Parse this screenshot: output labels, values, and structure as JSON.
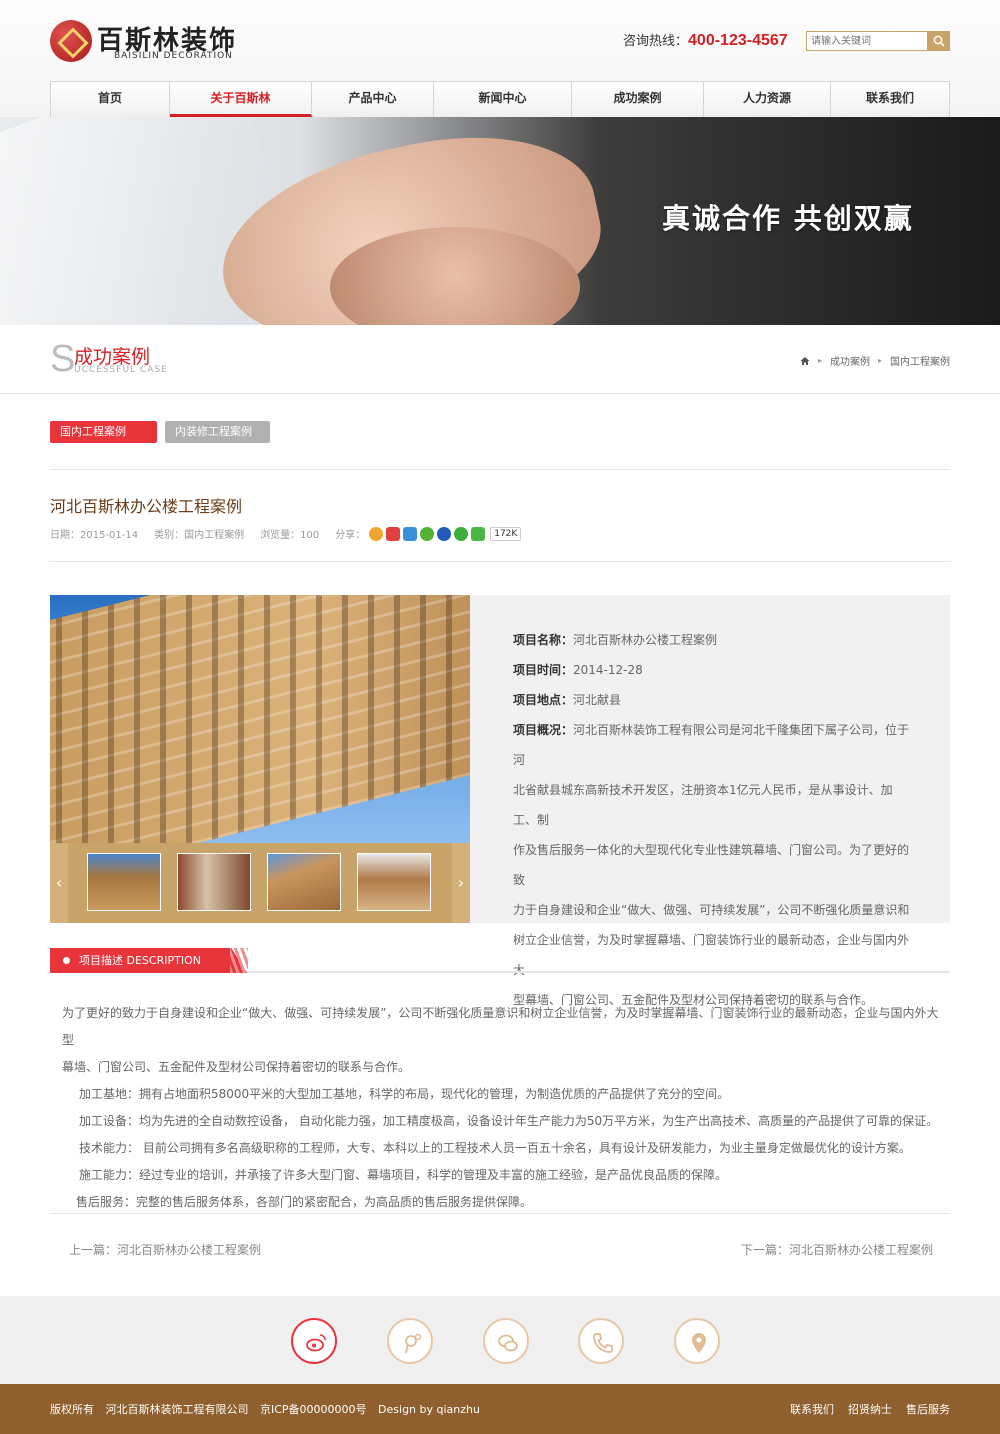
{
  "header": {
    "logo_cn": "百斯林装饰",
    "logo_en": "BAISILIN DECORATION",
    "hotline_label": "咨询热线：",
    "hotline_number": "400-123-4567",
    "search_placeholder": "请输入关键词"
  },
  "nav": [
    "首页",
    "关于百斯林",
    "产品中心",
    "新闻中心",
    "成功案例",
    "人力资源",
    "联系我们"
  ],
  "banner": {
    "slogan": "真诚合作  共创双赢"
  },
  "section": {
    "letter": "S",
    "title": "成功案例",
    "subtitle": "UCCESSFUL CASE",
    "breadcrumb": [
      "成功案例",
      "国内工程案例"
    ]
  },
  "tabs": {
    "domestic": "国内工程案例",
    "interior": "内装修工程案例"
  },
  "article": {
    "title": "河北百斯林办公楼工程案例",
    "date": "日期：2015-01-14",
    "category": "类别：国内工程案例",
    "views": "浏览量：100",
    "share_label": "分享：",
    "share_count": "172K"
  },
  "project": {
    "name_label": "项目名称：",
    "name": "河北百斯林办公楼工程案例",
    "time_label": "项目时间：",
    "time": "2014-12-28",
    "place_label": "项目地点：",
    "place": "河北献县",
    "summary_label": "项目概况：",
    "summary_lines": [
      "河北百斯林装饰工程有限公司是河北千隆集团下属子公司，位于河",
      "北省献县城东高新技术开发区，注册资本1亿元人民币，是从事设计、加工、制",
      "作及售后服务一体化的大型现代化专业性建筑幕墙、门窗公司。为了更好的致",
      "力于自身建设和企业“做大、做强、可持续发展”，公司不断强化质量意识和",
      "树立企业信誉，为及时掌握幕墙、门窗装饰行业的最新动态，企业与国内外大",
      "型幕墙、门窗公司、五金配件及型材公司保持着密切的联系与合作。"
    ]
  },
  "description": {
    "tag": "项目描述 DESCRIPTION",
    "lines": [
      "为了更好的致力于自身建设和企业“做大、做强、可持续发展”，公司不断强化质量意识和树立企业信誉，为及时掌握幕墙、门窗装饰行业的最新动态，企业与国内外大型",
      "幕墙、门窗公司、五金配件及型材公司保持着密切的联系与合作。",
      "加工基地：拥有占地面积58000平米的大型加工基地，科学的布局，现代化的管理，为制造优质的产品提供了充分的空间。",
      "加工设备：均为先进的全自动数控设备， 自动化能力强，加工精度极高，设备设计年生产能力为50万平方米，为生产出高技术、高质量的产品提供了可靠的保证。",
      "技术能力： 目前公司拥有多名高级职称的工程师，大专、本科以上的工程技术人员一百五十余名，具有设计及研发能力，为业主量身定做最优化的设计方案。",
      "施工能力：经过专业的培训，并承接了许多大型门窗、幕墙项目，科学的管理及丰富的施工经验，是产品优良品质的保障。",
      "售后服务：完整的售后服务体系，各部门的紧密配合，为高品质的售后服务提供保障。"
    ]
  },
  "pager": {
    "prev": "上一篇：河北百斯林办公楼工程案例",
    "next": "下一篇：河北百斯林办公楼工程案例"
  },
  "footer": {
    "icons": [
      "weibo-icon",
      "tencent-weibo-icon",
      "wechat-icon",
      "phone-icon",
      "location-icon"
    ],
    "copyright": "版权所有",
    "company": "河北百斯林装饰工程有限公司",
    "icp": "京ICP备00000000号",
    "design": "Design by qianzhu",
    "links": [
      "联系我们",
      "招贤纳士",
      "售后服务"
    ]
  },
  "colors": {
    "accent_red": "#e8343b",
    "brand_brown": "#8f5f2d",
    "gold": "#c9a46a"
  }
}
